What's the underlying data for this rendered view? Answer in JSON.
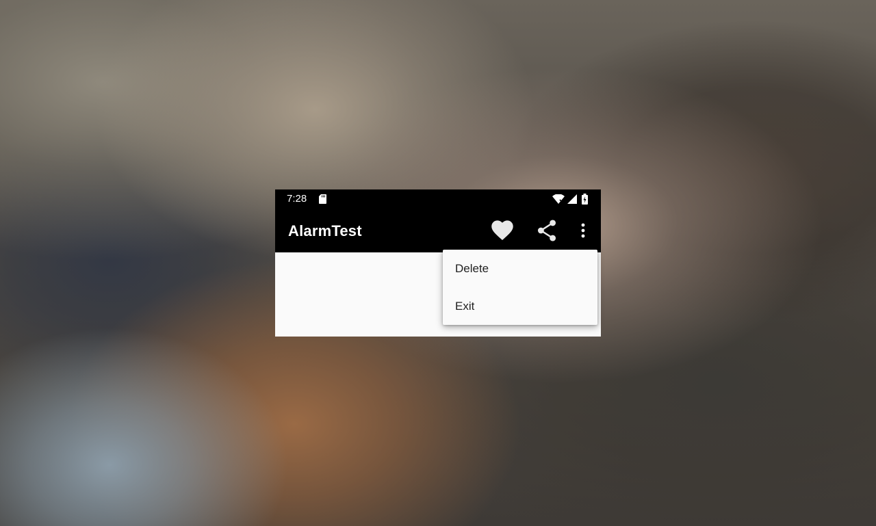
{
  "status_bar": {
    "time": "7:28",
    "icons": [
      "sd-card-icon",
      "wifi-icon",
      "signal-icon",
      "battery-icon"
    ]
  },
  "app_bar": {
    "title": "AlarmTest",
    "actions": [
      "heart-icon",
      "share-icon",
      "more-vert-icon"
    ]
  },
  "overflow_menu": {
    "items": [
      {
        "label": "Delete"
      },
      {
        "label": "Exit"
      }
    ]
  },
  "colors": {
    "app_bar_background": "#000000",
    "content_background": "#fafafa",
    "menu_text": "#212121",
    "icon_tint": "#ffffff"
  }
}
